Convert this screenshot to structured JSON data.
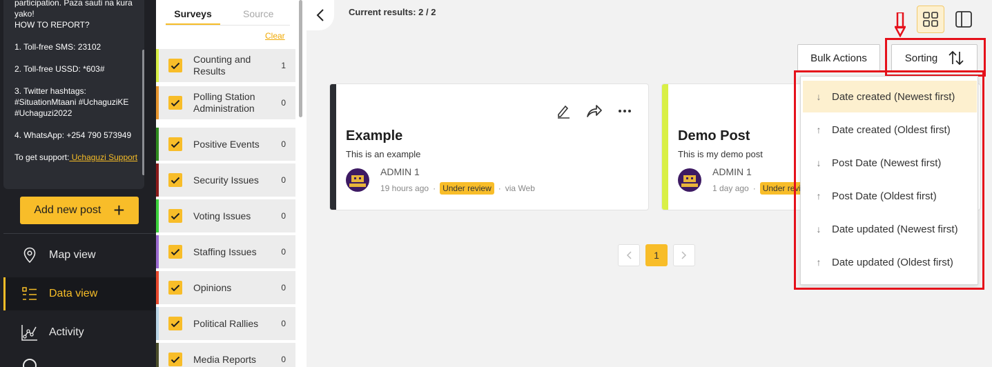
{
  "sidebar": {
    "info_lines": [
      "participation. Paza sauti na kura yako!",
      "HOW TO REPORT?",
      "",
      "1. Toll-free SMS: 23102",
      "",
      "2. Toll-free USSD: *603#",
      "",
      "3. Twitter hashtags: #SituationMtaani #UchaguziKE #Uchaguzi2022",
      "",
      "4. WhatsApp: +254 790 573949",
      "",
      "To get support:"
    ],
    "support_link": " Uchaguzi Support",
    "add_post_label": "Add new post",
    "nav": [
      {
        "label": "Map view",
        "icon": "map-pin-icon"
      },
      {
        "label": "Data view",
        "icon": "list-icon",
        "active": true
      },
      {
        "label": "Activity",
        "icon": "activity-icon"
      }
    ]
  },
  "filters": {
    "tabs": [
      "Surveys",
      "Source"
    ],
    "clear_label": "Clear",
    "surveys": [
      {
        "name": "Counting and Results",
        "count": "1",
        "color": "#d9f046"
      },
      {
        "name": "Polling Station Administration",
        "count": "0",
        "color": "#e8962e"
      },
      {
        "name": "Positive Events",
        "count": "0",
        "color": "#2f8a1f"
      },
      {
        "name": "Security Issues",
        "count": "0",
        "color": "#8a1b1b"
      },
      {
        "name": "Voting Issues",
        "count": "0",
        "color": "#3bd13b"
      },
      {
        "name": "Staffing Issues",
        "count": "0",
        "color": "#9b6bd1"
      },
      {
        "name": "Opinions",
        "count": "0",
        "color": "#e84a2e"
      },
      {
        "name": "Political Rallies",
        "count": "0",
        "color": "#b9d6e8"
      },
      {
        "name": "Media Reports",
        "count": "0",
        "color": "#4a4d2a"
      }
    ]
  },
  "main": {
    "results_text": "Current results: 2 / 2",
    "bulk_actions_label": "Bulk Actions",
    "sorting_label": "Sorting",
    "posts": [
      {
        "title": "Example",
        "description": "This is an example",
        "author": "ADMIN 1",
        "time": "19 hours ago",
        "status": "Under review",
        "source": "via Web",
        "color": "#2b2d33"
      },
      {
        "title": "Demo Post",
        "description": "This is my demo post",
        "author": "ADMIN 1",
        "time": "1 day ago",
        "status": "Under review",
        "source": "",
        "color": "#d9f046"
      }
    ],
    "pagination": {
      "current": "1"
    },
    "sort_options": [
      {
        "label": "Date created (Newest first)",
        "arrow": "↓",
        "selected": true
      },
      {
        "label": "Date created (Oldest first)",
        "arrow": "↑"
      },
      {
        "label": "Post Date (Newest first)",
        "arrow": "↓"
      },
      {
        "label": "Post Date (Oldest first)",
        "arrow": "↑"
      },
      {
        "label": "Date updated (Newest first)",
        "arrow": "↓"
      },
      {
        "label": "Date updated (Oldest first)",
        "arrow": "↑"
      }
    ],
    "annotation_color": "#e5101a"
  }
}
